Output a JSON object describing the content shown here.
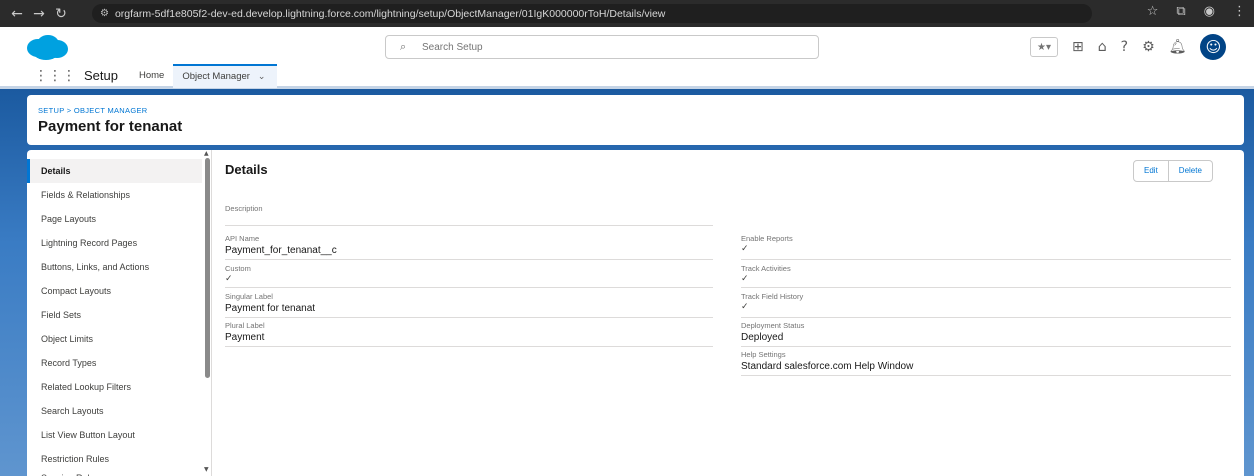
{
  "browser": {
    "url": "orgfarm-5df1e805f2-dev-ed.develop.lightning.force.com/lightning/setup/ObjectManager/01IgK000000rToH/Details/view"
  },
  "header": {
    "search_placeholder": "Search Setup"
  },
  "context_nav": {
    "app_name": "Setup",
    "home_label": "Home",
    "object_manager_label": "Object Manager"
  },
  "page_header": {
    "breadcrumb": "SETUP > OBJECT MANAGER",
    "title": "Payment for tenanat"
  },
  "sidebar": {
    "items": [
      {
        "label": "Details"
      },
      {
        "label": "Fields & Relationships"
      },
      {
        "label": "Page Layouts"
      },
      {
        "label": "Lightning Record Pages"
      },
      {
        "label": "Buttons, Links, and Actions"
      },
      {
        "label": "Compact Layouts"
      },
      {
        "label": "Field Sets"
      },
      {
        "label": "Object Limits"
      },
      {
        "label": "Record Types"
      },
      {
        "label": "Related Lookup Filters"
      },
      {
        "label": "Search Layouts"
      },
      {
        "label": "List View Button Layout"
      },
      {
        "label": "Restriction Rules"
      },
      {
        "label": "Scoping Rules"
      }
    ]
  },
  "details": {
    "title": "Details",
    "edit_label": "Edit",
    "delete_label": "Delete",
    "description_label": "Description",
    "api_name_label": "API Name",
    "api_name_value": "Payment_for_tenanat__c",
    "custom_label": "Custom",
    "singular_label_label": "Singular Label",
    "singular_label_value": "Payment for tenanat",
    "plural_label_label": "Plural Label",
    "plural_label_value": "Payment",
    "enable_reports_label": "Enable Reports",
    "track_activities_label": "Track Activities",
    "track_field_history_label": "Track Field History",
    "deployment_status_label": "Deployment Status",
    "deployment_status_value": "Deployed",
    "help_settings_label": "Help Settings",
    "help_settings_value": "Standard salesforce.com Help Window"
  }
}
